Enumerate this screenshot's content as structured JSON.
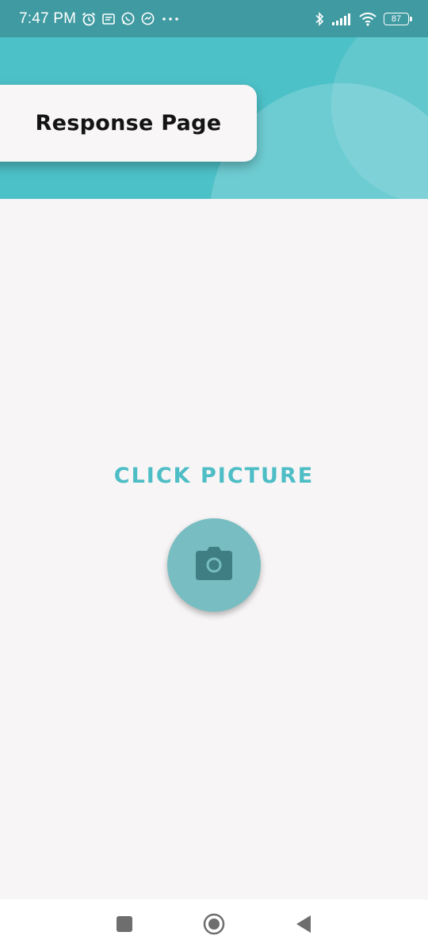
{
  "status_bar": {
    "time": "7:47 PM",
    "left_icons": [
      "alarm-icon",
      "message-icon",
      "whatsapp-icon",
      "messenger-icon",
      "more-dots-icon"
    ],
    "right_icons": [
      "bluetooth-icon",
      "signal-icon",
      "wifi-icon"
    ],
    "battery_level": "87"
  },
  "header": {
    "title": "Response Page",
    "color": "#4dc1c8"
  },
  "main": {
    "cta_label": "CLICK PICTURE",
    "cta_color": "#4dbdc6",
    "camera_button_icon": "camera-icon",
    "camera_button_color": "#78bdc1"
  },
  "nav_bar": {
    "buttons": [
      "recents-square-icon",
      "home-circle-icon",
      "back-triangle-icon"
    ]
  }
}
